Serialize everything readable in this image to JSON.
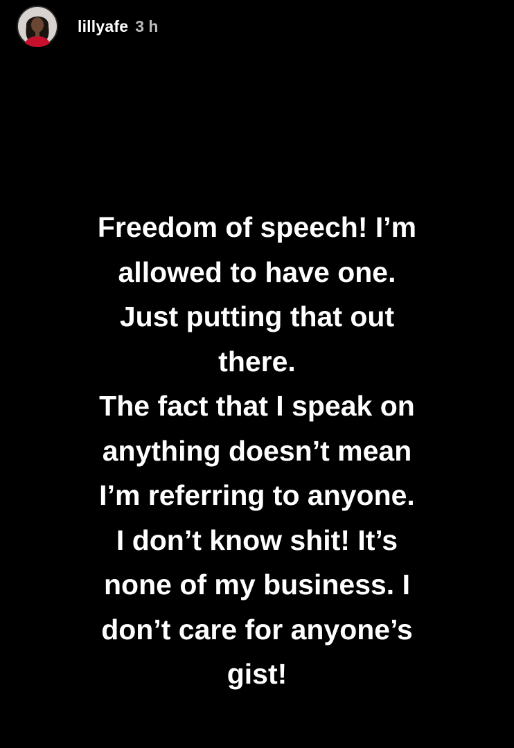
{
  "story": {
    "username": "lillyafe",
    "timestamp": "3 h",
    "avatar_icon": "profile-avatar",
    "background_color": "#000000",
    "text_color": "#ffffff",
    "lines": [
      "Freedom of speech! I’m",
      "allowed to have one.",
      "Just putting that out",
      "there.",
      "The fact that I speak on",
      "anything doesn’t mean",
      "I’m referring to anyone.",
      "I don’t know shit! It’s",
      "none of my business. I",
      "don’t care for anyone’s",
      "gist!"
    ]
  }
}
